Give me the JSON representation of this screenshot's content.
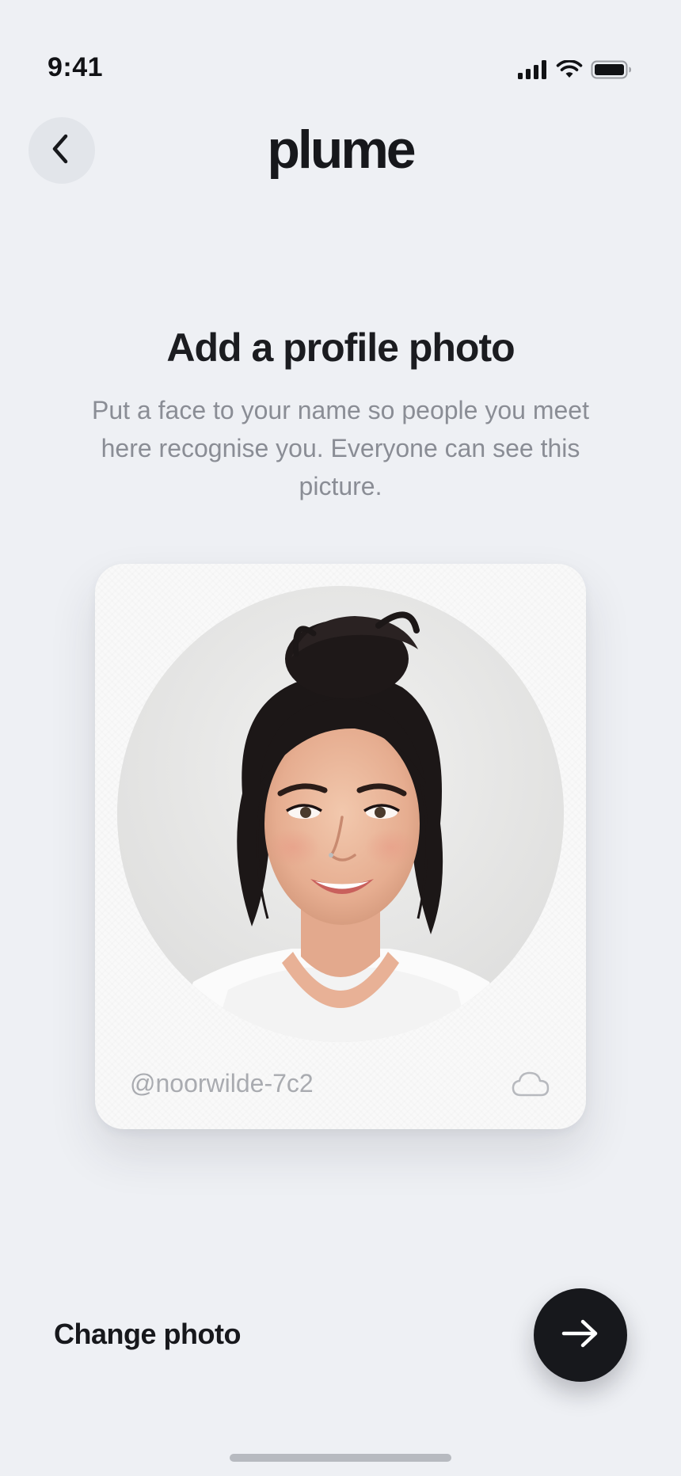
{
  "status_bar": {
    "time": "9:41",
    "icons": [
      "cellular-signal-icon",
      "wifi-icon",
      "battery-icon"
    ]
  },
  "header": {
    "back_icon": "chevron-left-icon",
    "logo": "plume"
  },
  "main": {
    "title": "Add a profile photo",
    "subtitle": "Put a face to your name so people you meet here recognise you. Everyone can see this picture."
  },
  "profile_card": {
    "username": "@noorwilde-7c2",
    "sync_icon": "cloud-icon"
  },
  "footer": {
    "change_photo_label": "Change photo",
    "next_icon": "arrow-right-icon"
  },
  "colors": {
    "background": "#eef0f4",
    "accent": "#17181c",
    "muted_text": "#8a8d95"
  }
}
